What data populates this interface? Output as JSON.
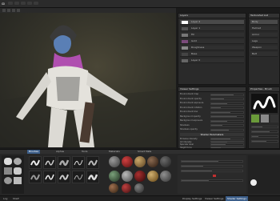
{
  "menubar": {
    "app_label": "ꝏ"
  },
  "layers_panel": {
    "title": "Layers",
    "layers": [
      "Layer 2",
      "Layer 1",
      "Fill",
      "Gold",
      "Roughness",
      "Base",
      "Layer 0"
    ]
  },
  "texture_set_panel": {
    "title": "TextureSet List",
    "items": [
      "Body",
      "Helmet",
      "Armor",
      "Legs",
      "Weapon",
      "Belt"
    ]
  },
  "properties_panel": {
    "title": "Properties - Brush"
  },
  "viewer_settings": {
    "title": "Viewer Settings",
    "shader_params_title": "Shader Parameters",
    "fields": [
      "Environment map",
      "Environment opacity",
      "Environment exposure",
      "Environment rotation",
      "Environment blur",
      "Background opacity",
      "Background exposure",
      "Shadows",
      "Shadows opacity"
    ],
    "slider_fractions": [
      0.7,
      0.4,
      0.5,
      0.3,
      0.6,
      0.8,
      0.5,
      0.35,
      0.55
    ],
    "shader_fields": [
      "Emissive intensity",
      "AO intensity",
      "Specular level",
      "Height force"
    ],
    "shader_slider_fractions": [
      0.6,
      0.5,
      0.45,
      0.3
    ]
  },
  "shelf": {
    "tabs": [
      "Brushes",
      "Alphas",
      "Tools",
      "Materials",
      "Smart Mats"
    ]
  },
  "status_tabs": [
    "Log",
    "Shelf",
    "Display Settings",
    "Viewer Settings",
    "Shader Settings"
  ],
  "colors": {
    "accent": "#3d5f8a",
    "highlight": "#c9a86a"
  }
}
